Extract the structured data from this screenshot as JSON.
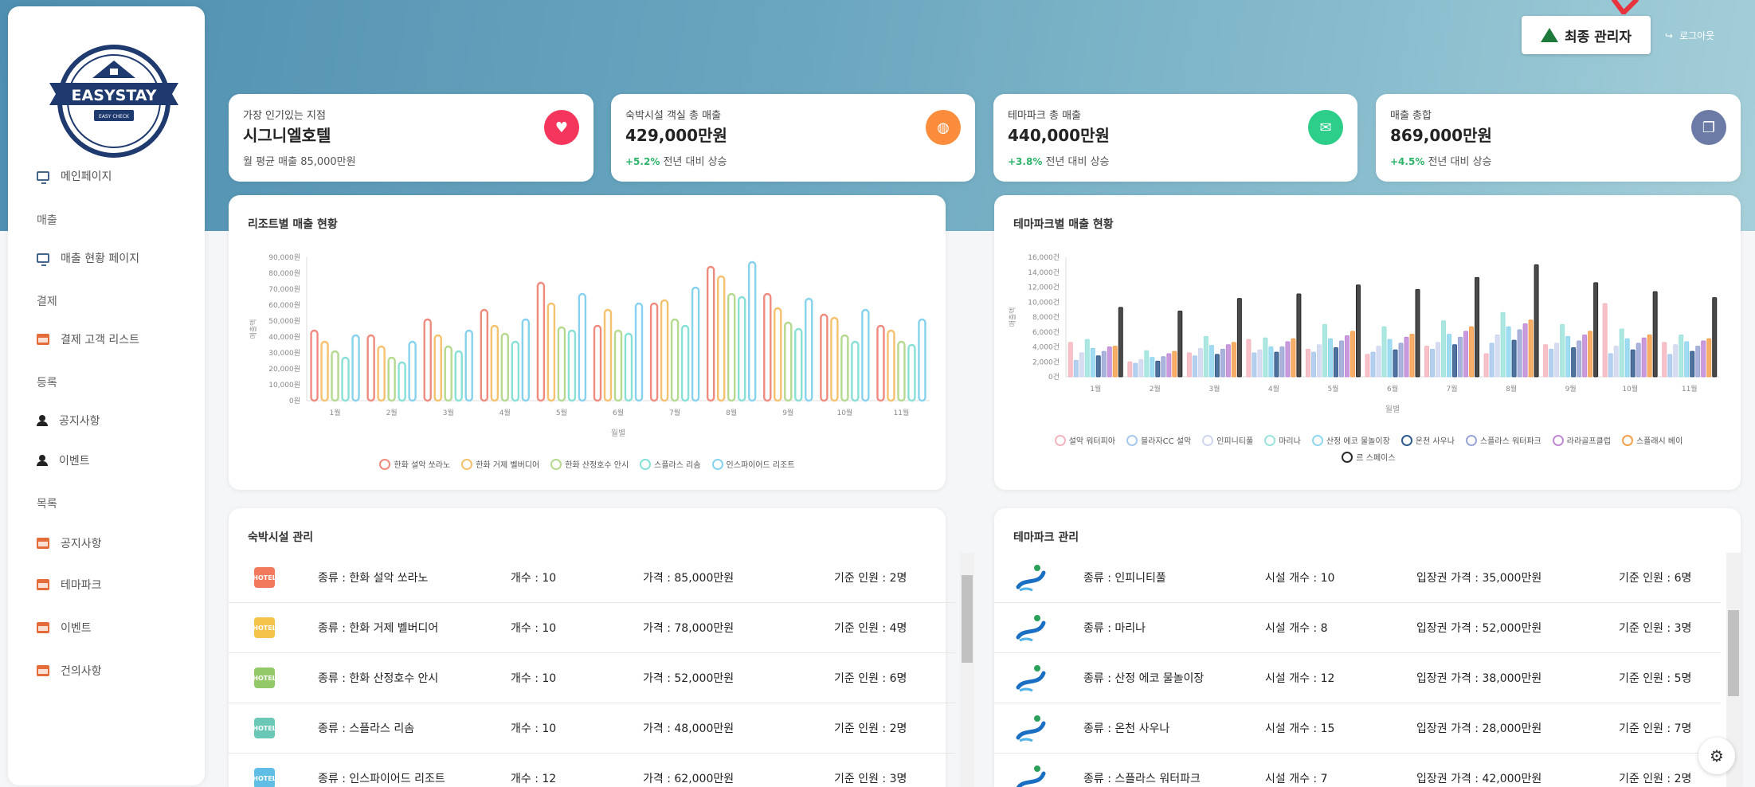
{
  "header": {
    "admin_label": "최종 관리자",
    "logout_label": "로그아웃"
  },
  "logo": {
    "name": "EASYSTAY",
    "sub": "EASY CHECK"
  },
  "sidebar": {
    "main": "메인페이지",
    "sales_head": "매출",
    "sales_page": "매출 현황 페이지",
    "pay_head": "결제",
    "pay_list": "결제 고객 리스트",
    "reg_head": "등록",
    "notice": "공지사항",
    "event": "이벤트",
    "list_head": "목록",
    "list_notice": "공지사항",
    "list_theme": "테마파크",
    "list_event": "이벤트",
    "list_suggest": "건의사항"
  },
  "cards": [
    {
      "label": "가장 인기있는 지점",
      "value": "시그니엘호텔",
      "sub": "월 평균 매출 85,000만원",
      "pct": "",
      "color": "#f5365c",
      "icon": "heart-icon"
    },
    {
      "label": "숙박시설 객실 총 매출",
      "value": "429,000만원",
      "sub": " 전년 대비 상승",
      "pct": "+5.2%",
      "color": "#fb8c3c",
      "icon": "globe-icon"
    },
    {
      "label": "테마파크 총 매출",
      "value": "440,000만원",
      "sub": " 전년 대비 상승",
      "pct": "+3.8%",
      "color": "#2dce89",
      "icon": "mail-icon"
    },
    {
      "label": "매출 총합",
      "value": "869,000만원",
      "sub": " 전년 대비 상승",
      "pct": "+4.5%",
      "color": "#6b7ba6",
      "icon": "copy-icon"
    }
  ],
  "chart1": {
    "title": "리조트별 매출 현황",
    "xlabel": "월별",
    "ylabel": "매출액",
    "ticks": [
      "90,000원",
      "80,000원",
      "70,000원",
      "60,000원",
      "50,000원",
      "40,000원",
      "30,000원",
      "20,000원",
      "10,000원",
      "0원"
    ]
  },
  "chart2": {
    "title": "테마파크별 매출 현황",
    "xlabel": "월별",
    "ylabel": "매출액",
    "ticks": [
      "16,000건",
      "14,000건",
      "12,000건",
      "10,000건",
      "8,000건",
      "6,000건",
      "4,000건",
      "2,000건",
      "0건"
    ]
  },
  "chart_data": [
    {
      "type": "bar",
      "title": "리조트별 매출 현황",
      "xlabel": "월별",
      "ylabel": "매출액",
      "ylim": [
        0,
        90000
      ],
      "categories": [
        "1월",
        "2월",
        "3월",
        "4월",
        "5월",
        "6월",
        "7월",
        "8월",
        "9월",
        "10월",
        "11월"
      ],
      "series": [
        {
          "name": "한화 설악 쏘라노",
          "color": "#f08a7e",
          "values": [
            44000,
            41000,
            51000,
            57000,
            74000,
            47000,
            61000,
            84000,
            67000,
            54000,
            47000
          ]
        },
        {
          "name": "한화 거제 벨버디어",
          "color": "#f5c16c",
          "values": [
            37000,
            34000,
            41000,
            47000,
            61000,
            57000,
            63000,
            78000,
            58000,
            52000,
            44000
          ]
        },
        {
          "name": "한화 산정호수 안시",
          "color": "#b5d98f",
          "values": [
            31000,
            27000,
            34000,
            42000,
            46000,
            44000,
            51000,
            67000,
            49000,
            41000,
            37000
          ]
        },
        {
          "name": "스플라스 리솜",
          "color": "#86e0d6",
          "values": [
            27000,
            24000,
            31000,
            37000,
            44000,
            42000,
            47000,
            65000,
            45000,
            37000,
            35000
          ]
        },
        {
          "name": "인스파이어드 리조트",
          "color": "#86d2ee",
          "values": [
            41000,
            37000,
            44000,
            51000,
            67000,
            61000,
            71000,
            87000,
            64000,
            57000,
            51000
          ]
        }
      ]
    },
    {
      "type": "bar",
      "title": "테마파크별 매출 현황",
      "xlabel": "월별",
      "ylabel": "매출액",
      "ylim": [
        0,
        16000
      ],
      "categories": [
        "1월",
        "2월",
        "3월",
        "4월",
        "5월",
        "6월",
        "7월",
        "8월",
        "9월",
        "10월",
        "11월"
      ],
      "series": [
        {
          "name": "설악 워터피아",
          "color": "#f4b6be",
          "values": [
            4600,
            2000,
            3200,
            5000,
            3700,
            3000,
            4100,
            3100,
            4300,
            9800,
            4600
          ]
        },
        {
          "name": "블라자CC 설악",
          "color": "#a8c8ec",
          "values": [
            2200,
            1800,
            2800,
            3200,
            3300,
            3300,
            3700,
            4500,
            3700,
            3100,
            3000
          ]
        },
        {
          "name": "인피니티풀",
          "color": "#cfd6ee",
          "values": [
            3200,
            2300,
            3800,
            3600,
            4300,
            4100,
            4600,
            5600,
            4500,
            4100,
            4300
          ]
        },
        {
          "name": "마리나",
          "color": "#9ee3dc",
          "values": [
            5000,
            3500,
            5400,
            5200,
            7000,
            6700,
            7500,
            8600,
            7000,
            6400,
            5600
          ]
        },
        {
          "name": "산정 에코 물놀이장",
          "color": "#8fd6ee",
          "values": [
            3800,
            2600,
            4200,
            4000,
            5100,
            5000,
            5700,
            6700,
            5400,
            5100,
            4700
          ]
        },
        {
          "name": "온천 사우나",
          "color": "#315a8c",
          "values": [
            2800,
            2100,
            3000,
            3300,
            3900,
            3600,
            4300,
            4900,
            3900,
            3600,
            3400
          ]
        },
        {
          "name": "스플라스 워터파크",
          "color": "#9aa6d6",
          "values": [
            3400,
            2700,
            3700,
            4000,
            4800,
            4500,
            5300,
            6300,
            4800,
            4500,
            4100
          ]
        },
        {
          "name": "라라골프클럽",
          "color": "#c08ad6",
          "values": [
            4000,
            3100,
            4300,
            4700,
            5500,
            5300,
            6100,
            7100,
            5600,
            5200,
            4800
          ]
        },
        {
          "name": "스플래시 베이",
          "color": "#f5a04e",
          "values": [
            4100,
            3400,
            4600,
            5100,
            6100,
            5700,
            6700,
            7600,
            6100,
            5600,
            5100
          ]
        },
        {
          "name": "르 스페이스",
          "color": "#2a2a2a",
          "values": [
            9300,
            8800,
            10500,
            11100,
            12300,
            11700,
            13300,
            15000,
            12600,
            11400,
            10600
          ]
        }
      ]
    }
  ],
  "lodging": {
    "title": "숙박시설 관리",
    "rows": [
      {
        "kind": "종류 : 한화 설악 쏘라노",
        "count": "개수 : 10",
        "price": "가격 : 85,000만원",
        "people": "기준 인원 : 2명",
        "color": "#f2795c"
      },
      {
        "kind": "종류 : 한화 거제 벨버디어",
        "count": "개수 : 10",
        "price": "가격 : 78,000만원",
        "people": "기준 인원 : 4명",
        "color": "#f5c34a"
      },
      {
        "kind": "종류 : 한화 산정호수 안시",
        "count": "개수 : 10",
        "price": "가격 : 52,000만원",
        "people": "기준 인원 : 6명",
        "color": "#94c96a"
      },
      {
        "kind": "종류 : 스플라스 리솜",
        "count": "개수 : 10",
        "price": "가격 : 48,000만원",
        "people": "기준 인원 : 2명",
        "color": "#6cc8b6"
      },
      {
        "kind": "종류 : 인스파이어드 리조트",
        "count": "개수 : 12",
        "price": "가격 : 62,000만원",
        "people": "기준 인원 : 3명",
        "color": "#5fbde6"
      }
    ],
    "icon_text": "HOTEL"
  },
  "theme": {
    "title": "테마파크 관리",
    "rows": [
      {
        "kind": "종류 : 인피니티풀",
        "count": "시설 개수 : 10",
        "price": "입장권 가격 : 35,000만원",
        "people": "기준 인원 : 6명"
      },
      {
        "kind": "종류 : 마리나",
        "count": "시설 개수 : 8",
        "price": "입장권 가격 : 52,000만원",
        "people": "기준 인원 : 3명"
      },
      {
        "kind": "종류 : 산정 에코 물놀이장",
        "count": "시설 개수 : 12",
        "price": "입장권 가격 : 38,000만원",
        "people": "기준 인원 : 5명"
      },
      {
        "kind": "종류 : 온천 사우나",
        "count": "시설 개수 : 15",
        "price": "입장권 가격 : 28,000만원",
        "people": "기준 인원 : 7명"
      },
      {
        "kind": "종류 : 스플라스 워터파크",
        "count": "시설 개수 : 7",
        "price": "입장권 가격 : 42,000만원",
        "people": "기준 인원 : 2명"
      }
    ]
  }
}
